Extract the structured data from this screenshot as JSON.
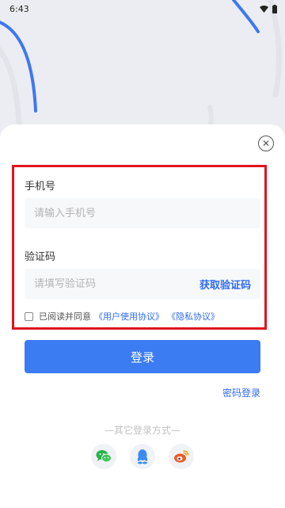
{
  "status_bar": {
    "time": "6:43"
  },
  "colors": {
    "accent": "#3b7cf2",
    "highlight": "#e0141e"
  },
  "form": {
    "phone_label": "手机号",
    "phone_placeholder": "请输入手机号",
    "code_label": "验证码",
    "code_placeholder": "请填写验证码",
    "get_code": "获取验证码"
  },
  "agreement": {
    "prefix": "已阅读并同意",
    "user_agreement": "《用户使用协议》",
    "privacy": "《隐私协议》"
  },
  "login_button": "登录",
  "password_login": "密码登录",
  "other_methods": "—其它登录方式—",
  "social": [
    "wechat-icon",
    "qq-icon",
    "weibo-icon"
  ]
}
